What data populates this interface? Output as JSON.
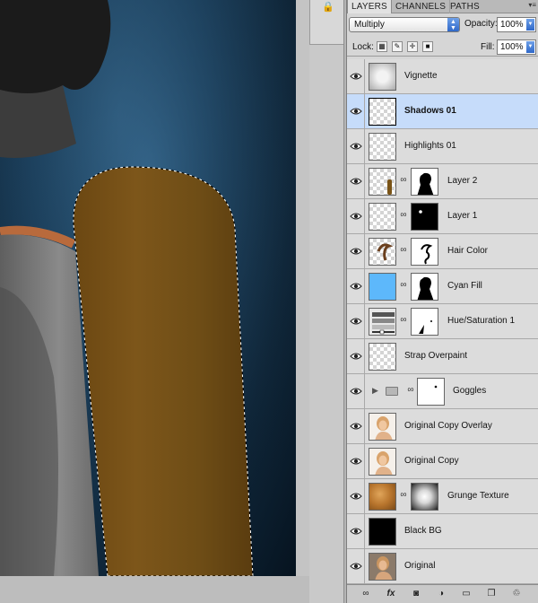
{
  "panel": {
    "tabs": [
      "LAYERS",
      "CHANNELS",
      "PATHS"
    ],
    "blend_mode": "Multiply",
    "opacity_label": "Opacity:",
    "opacity_value": "100%",
    "lock_label": "Lock:",
    "fill_label": "Fill:",
    "fill_value": "100%"
  },
  "layers": [
    {
      "name": "Vignette",
      "visible": true,
      "selected": false,
      "thumb": "vignette",
      "mask": null
    },
    {
      "name": "Shadows 01",
      "visible": true,
      "selected": true,
      "thumb": "transparent",
      "mask": null
    },
    {
      "name": "Highlights 01",
      "visible": true,
      "selected": false,
      "thumb": "transparent",
      "mask": null
    },
    {
      "name": "Layer 2",
      "visible": true,
      "selected": false,
      "thumb": "brown-strip",
      "mask": "silhouette"
    },
    {
      "name": "Layer 1",
      "visible": true,
      "selected": false,
      "thumb": "transparent",
      "mask": "black-dot"
    },
    {
      "name": "Hair Color",
      "visible": true,
      "selected": false,
      "thumb": "hair-stroke",
      "mask": "hair-outline"
    },
    {
      "name": "Cyan Fill",
      "visible": true,
      "selected": false,
      "thumb": "cyan-fill",
      "mask": "silhouette"
    },
    {
      "name": "Hue/Saturation 1",
      "visible": true,
      "selected": false,
      "thumb": "hue-sat-adjustment",
      "mask": "white-mark"
    },
    {
      "name": "Strap Overpaint",
      "visible": true,
      "selected": false,
      "thumb": "transparent",
      "mask": null
    },
    {
      "name": "Goggles",
      "visible": true,
      "selected": false,
      "thumb": "group-folder",
      "mask": "white-dot"
    },
    {
      "name": "Original Copy Overlay",
      "visible": true,
      "selected": false,
      "thumb": "photo",
      "mask": null
    },
    {
      "name": "Original Copy",
      "visible": true,
      "selected": false,
      "thumb": "photo",
      "mask": null
    },
    {
      "name": "Grunge Texture",
      "visible": true,
      "selected": false,
      "thumb": "grunge",
      "mask": "radial-gradient"
    },
    {
      "name": "Black BG",
      "visible": true,
      "selected": false,
      "thumb": "black",
      "mask": null
    },
    {
      "name": "Original",
      "visible": true,
      "selected": false,
      "thumb": "photo",
      "mask": null
    }
  ],
  "bottom_toolbar": [
    "link-layers-icon",
    "fx-icon",
    "add-mask-icon",
    "adjustment-icon",
    "new-group-icon",
    "new-layer-icon",
    "trash-icon"
  ],
  "colors": {
    "selected_row": "#c6dcfa",
    "cyan_fill": "#5db8fb",
    "canvas_bg": "#1d4463",
    "selection_fill": "#7a5417"
  }
}
